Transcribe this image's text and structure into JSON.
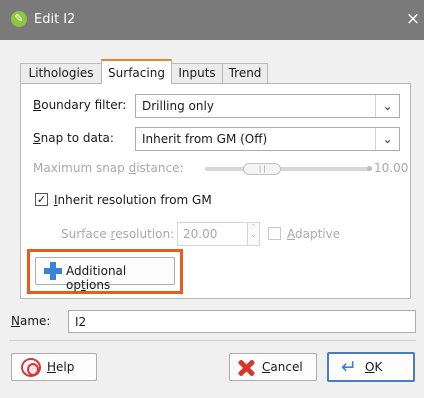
{
  "window": {
    "title": "Edit I2",
    "app_icon_glyph": "✎",
    "close_glyph": "×"
  },
  "tabs": [
    {
      "label": "Lithologies",
      "active": false
    },
    {
      "label": "Surfacing",
      "active": true
    },
    {
      "label": "Inputs",
      "active": false
    },
    {
      "label": "Trend",
      "active": false
    }
  ],
  "surfacing": {
    "boundary_filter": {
      "label_mnemonic": "B",
      "label_rest": "oundary filter:",
      "value": "Drilling only"
    },
    "snap_to_data": {
      "label_mnemonic": "S",
      "label_rest": "nap to data:",
      "value": "Inherit from GM (Off)"
    },
    "max_snap_distance": {
      "label_pre": "Maximum snap ",
      "label_mnemonic": "d",
      "label_post": "istance:",
      "value": "10.00",
      "level": 0.35,
      "enabled": false
    },
    "inherit_resolution": {
      "checked": true,
      "label_mnemonic": "I",
      "label_rest": "nherit resolution from GM"
    },
    "surface_resolution": {
      "label_pre": "Surface ",
      "label_mnemonic": "r",
      "label_post": "esolution:",
      "value": "20.00",
      "enabled": false
    },
    "adaptive": {
      "checked": false,
      "label_mnemonic": "A",
      "label_rest": "daptive",
      "enabled": false
    },
    "additional_options": {
      "label_pre": "Additional op",
      "label_mnemonic": "t",
      "label_post": "ions",
      "icon": "plus-icon"
    }
  },
  "name_field": {
    "label_mnemonic": "N",
    "label_rest": "ame:",
    "value": "I2"
  },
  "footer": {
    "help": {
      "label_mnemonic": "H",
      "label_rest": "elp",
      "icon": "help-lifebuoy-icon"
    },
    "cancel": {
      "label_mnemonic": "C",
      "label_rest": "ancel",
      "icon": "cancel-x-icon"
    },
    "ok": {
      "label_mnemonic": "O",
      "label_rest": "K",
      "icon": "ok-enter-icon"
    }
  },
  "colors": {
    "titlebar": "#7a7a7a",
    "highlight_border": "#ec5a1f",
    "accent_blue": "#3a84d6",
    "cancel_red": "#d4372d"
  }
}
